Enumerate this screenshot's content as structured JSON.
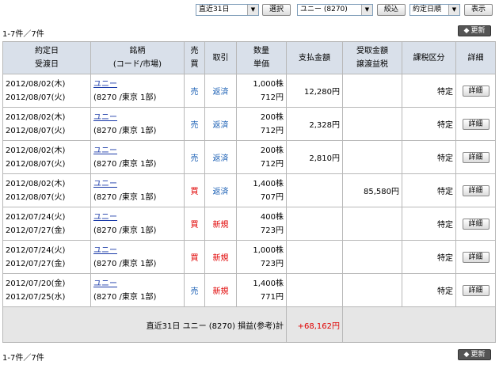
{
  "filters": {
    "period": "直近31日",
    "select_button": "選択",
    "stock": "ユニー (8270)",
    "narrow_button": "絞込",
    "sort": "約定日順",
    "show_button": "表示"
  },
  "count_text": "1-7件／7件",
  "refresh_label": "更新",
  "headers": {
    "date_top": "約定日",
    "date_bottom": "受渡日",
    "issue_top": "銘柄",
    "issue_bottom": "(コード/市場)",
    "side_top": "売",
    "side_bottom": "買",
    "trade": "取引",
    "qty_top": "数量",
    "qty_bottom": "単価",
    "payment": "支払金額",
    "receipt_top": "受取金額",
    "receipt_bottom": "譲渡益税",
    "tax_class": "課税区分",
    "detail": "詳細"
  },
  "rows": [
    {
      "trade_date": "2012/08/02(木)",
      "settle_date": "2012/08/07(火)",
      "name": "ユニー",
      "code": "(8270 /東京 1部)",
      "side": "売",
      "side_color": "#1a5fb4",
      "trade": "返済",
      "trade_color": "#1a5fb4",
      "qty": "1,000株",
      "price": "712円",
      "payment": "12,280円",
      "receipt": "",
      "tax_class": "特定",
      "detail": "詳細"
    },
    {
      "trade_date": "2012/08/02(木)",
      "settle_date": "2012/08/07(火)",
      "name": "ユニー",
      "code": "(8270 /東京 1部)",
      "side": "売",
      "side_color": "#1a5fb4",
      "trade": "返済",
      "trade_color": "#1a5fb4",
      "qty": "200株",
      "price": "712円",
      "payment": "2,328円",
      "receipt": "",
      "tax_class": "特定",
      "detail": "詳細"
    },
    {
      "trade_date": "2012/08/02(木)",
      "settle_date": "2012/08/07(火)",
      "name": "ユニー",
      "code": "(8270 /東京 1部)",
      "side": "売",
      "side_color": "#1a5fb4",
      "trade": "返済",
      "trade_color": "#1a5fb4",
      "qty": "200株",
      "price": "712円",
      "payment": "2,810円",
      "receipt": "",
      "tax_class": "特定",
      "detail": "詳細"
    },
    {
      "trade_date": "2012/08/02(木)",
      "settle_date": "2012/08/07(火)",
      "name": "ユニー",
      "code": "(8270 /東京 1部)",
      "side": "買",
      "side_color": "#e00000",
      "trade": "返済",
      "trade_color": "#1a5fb4",
      "qty": "1,400株",
      "price": "707円",
      "payment": "",
      "receipt": "85,580円",
      "tax_class": "特定",
      "detail": "詳細"
    },
    {
      "trade_date": "2012/07/24(火)",
      "settle_date": "2012/07/27(金)",
      "name": "ユニー",
      "code": "(8270 /東京 1部)",
      "side": "買",
      "side_color": "#e00000",
      "trade": "新規",
      "trade_color": "#e00000",
      "qty": "400株",
      "price": "723円",
      "payment": "",
      "receipt": "",
      "tax_class": "特定",
      "detail": "詳細"
    },
    {
      "trade_date": "2012/07/24(火)",
      "settle_date": "2012/07/27(金)",
      "name": "ユニー",
      "code": "(8270 /東京 1部)",
      "side": "買",
      "side_color": "#e00000",
      "trade": "新規",
      "trade_color": "#e00000",
      "qty": "1,000株",
      "price": "723円",
      "payment": "",
      "receipt": "",
      "tax_class": "特定",
      "detail": "詳細"
    },
    {
      "trade_date": "2012/07/20(金)",
      "settle_date": "2012/07/25(水)",
      "name": "ユニー",
      "code": "(8270 /東京 1部)",
      "side": "売",
      "side_color": "#1a5fb4",
      "trade": "新規",
      "trade_color": "#e00000",
      "qty": "1,400株",
      "price": "771円",
      "payment": "",
      "receipt": "",
      "tax_class": "特定",
      "detail": "詳細"
    }
  ],
  "total": {
    "label": "直近31日 ユニー (8270) 損益(参考)計",
    "value": "+68,162円"
  }
}
